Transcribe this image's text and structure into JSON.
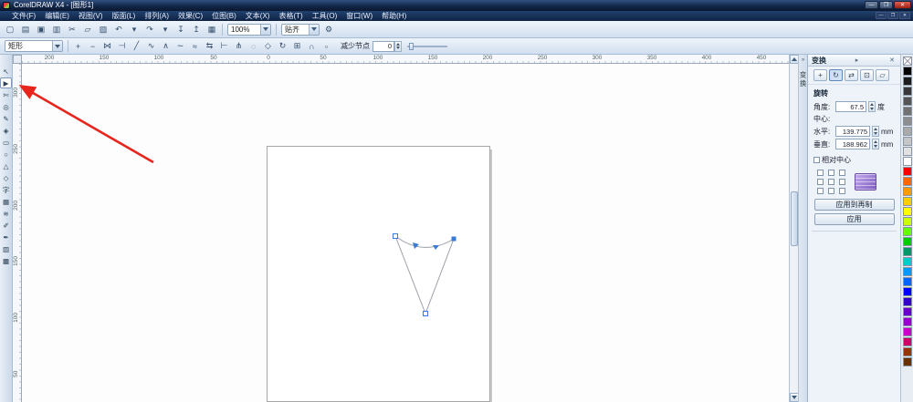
{
  "window": {
    "title": "CorelDRAW X4 - [图形1]",
    "minimize": "—",
    "maximize": "❐",
    "close": "✕"
  },
  "menu": {
    "items": [
      "文件(F)",
      "编辑(E)",
      "视图(V)",
      "版面(L)",
      "排列(A)",
      "效果(C)",
      "位图(B)",
      "文本(X)",
      "表格(T)",
      "工具(O)",
      "窗口(W)",
      "帮助(H)"
    ]
  },
  "doc_window": {
    "minimize": "—",
    "restore": "❐",
    "close": "✕"
  },
  "toolbar": {
    "icons": [
      {
        "name": "new-icon",
        "glyph": "▢"
      },
      {
        "name": "open-icon",
        "glyph": "▤"
      },
      {
        "name": "save-icon",
        "glyph": "▣"
      },
      {
        "name": "print-icon",
        "glyph": "▥"
      },
      {
        "name": "cut-icon",
        "glyph": "✂"
      },
      {
        "name": "copy-icon",
        "glyph": "▱"
      },
      {
        "name": "paste-icon",
        "glyph": "▨"
      },
      {
        "name": "undo-icon",
        "glyph": "↶"
      },
      {
        "name": "undo-dropdown-icon",
        "glyph": "▾"
      },
      {
        "name": "redo-icon",
        "glyph": "↷"
      },
      {
        "name": "redo-dropdown-icon",
        "glyph": "▾"
      },
      {
        "name": "import-icon",
        "glyph": "↧"
      },
      {
        "name": "export-icon",
        "glyph": "↥"
      },
      {
        "name": "app-launcher-icon",
        "glyph": "▦"
      }
    ],
    "zoom_value": "100%",
    "snap_label": "贴齐",
    "options_icon": "⚙"
  },
  "property_bar": {
    "preset_value": "矩形",
    "icons": [
      {
        "name": "add-node-icon",
        "glyph": "+"
      },
      {
        "name": "delete-node-icon",
        "glyph": "−"
      },
      {
        "name": "join-nodes-icon",
        "glyph": "⋈"
      },
      {
        "name": "break-node-icon",
        "glyph": "⊣"
      },
      {
        "name": "to-line-icon",
        "glyph": "╱"
      },
      {
        "name": "to-curve-icon",
        "glyph": "∿"
      },
      {
        "name": "cusp-node-icon",
        "glyph": "∧"
      },
      {
        "name": "smooth-node-icon",
        "glyph": "∼"
      },
      {
        "name": "symmetric-node-icon",
        "glyph": "≈"
      },
      {
        "name": "reverse-direction-icon",
        "glyph": "⇆"
      },
      {
        "name": "extend-curve-icon",
        "glyph": "⊢"
      },
      {
        "name": "extract-subpath-icon",
        "glyph": "⋔"
      },
      {
        "name": "close-curve-icon",
        "glyph": "◌"
      },
      {
        "name": "stretch-nodes-icon",
        "glyph": "◇"
      },
      {
        "name": "rotate-nodes-icon",
        "glyph": "↻"
      },
      {
        "name": "align-nodes-icon",
        "glyph": "⊞"
      },
      {
        "name": "elastic-mode-icon",
        "glyph": "∩"
      },
      {
        "name": "select-all-nodes-icon",
        "glyph": "▫"
      }
    ],
    "reduce_nodes_label": "减少节点",
    "reduce_nodes_value": "0"
  },
  "toolbox": {
    "tools": [
      {
        "name": "pick-tool",
        "glyph": "↖",
        "state": ""
      },
      {
        "name": "shape-tool",
        "glyph": "▶",
        "state": "active"
      },
      {
        "name": "crop-tool",
        "glyph": "✄",
        "state": ""
      },
      {
        "name": "zoom-tool",
        "glyph": "◎",
        "state": ""
      },
      {
        "name": "freehand-tool",
        "glyph": "✎",
        "state": ""
      },
      {
        "name": "smart-fill-tool",
        "glyph": "◈",
        "state": ""
      },
      {
        "name": "rectangle-tool",
        "glyph": "▭",
        "state": ""
      },
      {
        "name": "ellipse-tool",
        "glyph": "○",
        "state": ""
      },
      {
        "name": "polygon-tool",
        "glyph": "△",
        "state": ""
      },
      {
        "name": "basic-shapes-tool",
        "glyph": "◇",
        "state": ""
      },
      {
        "name": "text-tool",
        "glyph": "字",
        "state": ""
      },
      {
        "name": "table-tool",
        "glyph": "▦",
        "state": ""
      },
      {
        "name": "blend-tool",
        "glyph": "≋",
        "state": ""
      },
      {
        "name": "eyedropper-tool",
        "glyph": "✐",
        "state": ""
      },
      {
        "name": "outline-tool",
        "glyph": "✒",
        "state": ""
      },
      {
        "name": "fill-tool",
        "glyph": "▨",
        "state": ""
      },
      {
        "name": "interactive-fill-tool",
        "glyph": "▩",
        "state": ""
      }
    ]
  },
  "ruler": {
    "h": [
      "200",
      "150",
      "100",
      "50",
      "0",
      "50",
      "100",
      "150",
      "200",
      "250",
      "300",
      "350",
      "400",
      "450"
    ],
    "v": [
      "300",
      "250",
      "200",
      "150",
      "100",
      "50"
    ]
  },
  "docker": {
    "tab_title": "变换",
    "collapse_icon": "»",
    "title": "变换",
    "flyout_icon": "▸",
    "close_icon": "✕",
    "buttons": [
      {
        "name": "transform-position-icon",
        "glyph": "+",
        "state": ""
      },
      {
        "name": "transform-rotate-icon",
        "glyph": "↻",
        "state": "active"
      },
      {
        "name": "transform-scale-mirror-icon",
        "glyph": "⇄",
        "state": ""
      },
      {
        "name": "transform-size-icon",
        "glyph": "⊡",
        "state": ""
      },
      {
        "name": "transform-skew-icon",
        "glyph": "▱",
        "state": ""
      }
    ],
    "section_label": "旋转",
    "angle_label": "角度:",
    "angle_value": "67.5",
    "angle_unit": "度",
    "center_label": "中心:",
    "horizontal_label": "水平:",
    "horizontal_value": "139.775",
    "horizontal_unit": "mm",
    "vertical_label": "垂直:",
    "vertical_value": "188.962",
    "vertical_unit": "mm",
    "relative_center_label": "相对中心",
    "apply_to_duplicate_label": "应用到再制",
    "apply_label": "应用"
  },
  "palette": {
    "colors": [
      "#000000",
      "#1c1c1c",
      "#383838",
      "#555555",
      "#717171",
      "#8d8d8d",
      "#aaaaaa",
      "#c6c6c6",
      "#e2e2e2",
      "#ffffff",
      "#ff0000",
      "#ff6600",
      "#ff9900",
      "#ffcc00",
      "#ffff00",
      "#ccff00",
      "#66ff00",
      "#00cc00",
      "#009966",
      "#00cccc",
      "#0099ff",
      "#0066ff",
      "#0000ff",
      "#3300cc",
      "#6600cc",
      "#9900cc",
      "#cc00cc",
      "#cc0066",
      "#993300",
      "#663300"
    ]
  },
  "annotation": {
    "arrow_color": "#e8251c"
  },
  "canvas": {
    "shape_stroke": "#9aa0a6",
    "node_color": "#3a7bd5"
  }
}
